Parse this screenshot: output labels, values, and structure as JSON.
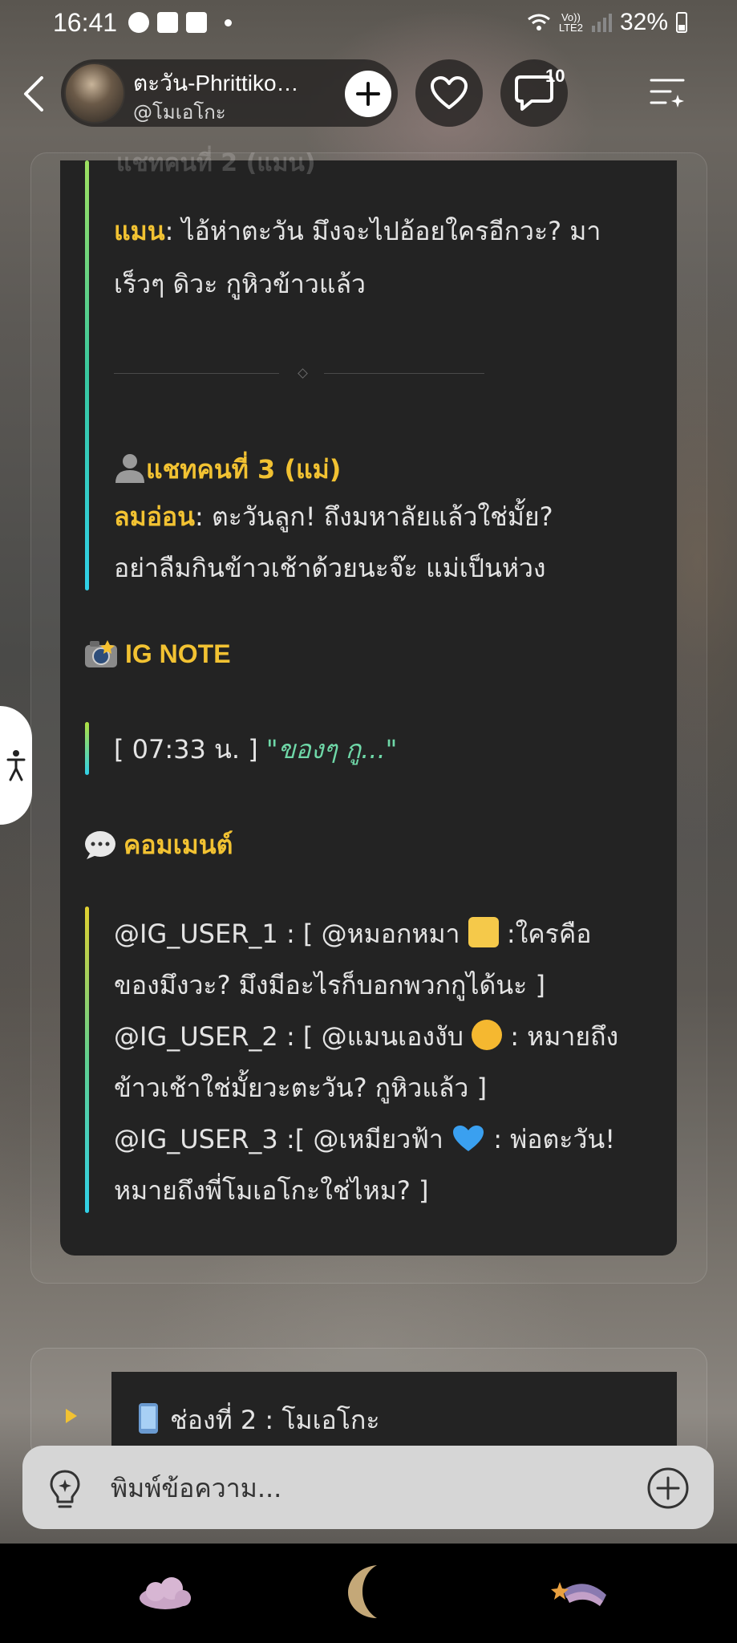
{
  "status_bar": {
    "time": "16:41",
    "network_top": "Vo))",
    "network_bottom": "LTE2",
    "battery": "32%"
  },
  "header": {
    "profile_name": "ตะวัน-Phrittiko…",
    "profile_handle": "@โมเอโกะ",
    "comment_count": "10"
  },
  "content": {
    "faded_heading": "แชทคนที่ 2 (แมน)",
    "man": {
      "speaker": "แมน",
      "line1": ": ไอ้ห่าตะวัน มึงจะไปอ้อยใครอีกวะ? มา",
      "line2": "เร็วๆ ดิวะ กูหิวข้าวแล้ว"
    },
    "mom": {
      "heading": "แชทคนที่ 3 (แม่)",
      "speaker": "ลมอ่อน",
      "line1": ": ตะวันลูก! ถึงมหาลัยแล้วใช่มั้ย?",
      "line2": "อย่าลืมกินข้าวเช้าด้วยนะจ๊ะ แม่เป็นห่วง"
    },
    "ig_note": {
      "heading": "IG NOTE",
      "time": "[ 07:33 น. ]",
      "quote": "\"ของๆ กู...\""
    },
    "comments": {
      "heading": "คอมเมนต์",
      "c1_a": "@IG_USER_1 : [ @หมอกหมา",
      "c1_b": " :ใครคือ",
      "c1_c": "ของมึงวะ? มึงมีอะไรก็บอกพวกกูได้นะ ]",
      "c2_a": "@IG_USER_2 : [ @แมนเองงับ",
      "c2_b": " : หมายถึง",
      "c2_c": "ข้าวเช้าใช่มั้ยวะตะวัน? กูหิวแล้ว ]",
      "c3_a": "@IG_USER_3 :[ @เหมียวฟ้า",
      "c3_b": " : พ่อตะวัน!",
      "c3_c": "หมายถึงพี่โมเอโกะใช่ไหม? ]"
    }
  },
  "card2": {
    "title": "ช่องที่ 2 : โมเอโกะ"
  },
  "composer": {
    "placeholder": "พิมพ์ข้อความ..."
  },
  "icons": {
    "back": "chevron-left-icon",
    "add": "plus-icon",
    "like": "heart-icon",
    "comments": "comment-bubble-icon",
    "menu": "menu-sparkle-icon",
    "accessibility": "accessibility-icon",
    "bulb": "lightbulb-icon",
    "attach": "plus-circle-icon",
    "nav1": "cloud-icon",
    "nav2": "moon-icon",
    "nav3": "shooting-star-icon"
  },
  "colors": {
    "accent_yellow": "#f2c232",
    "note_green": "#6fd8a8",
    "quote_cyan": "#3ad8e0",
    "panel": "#232323"
  }
}
